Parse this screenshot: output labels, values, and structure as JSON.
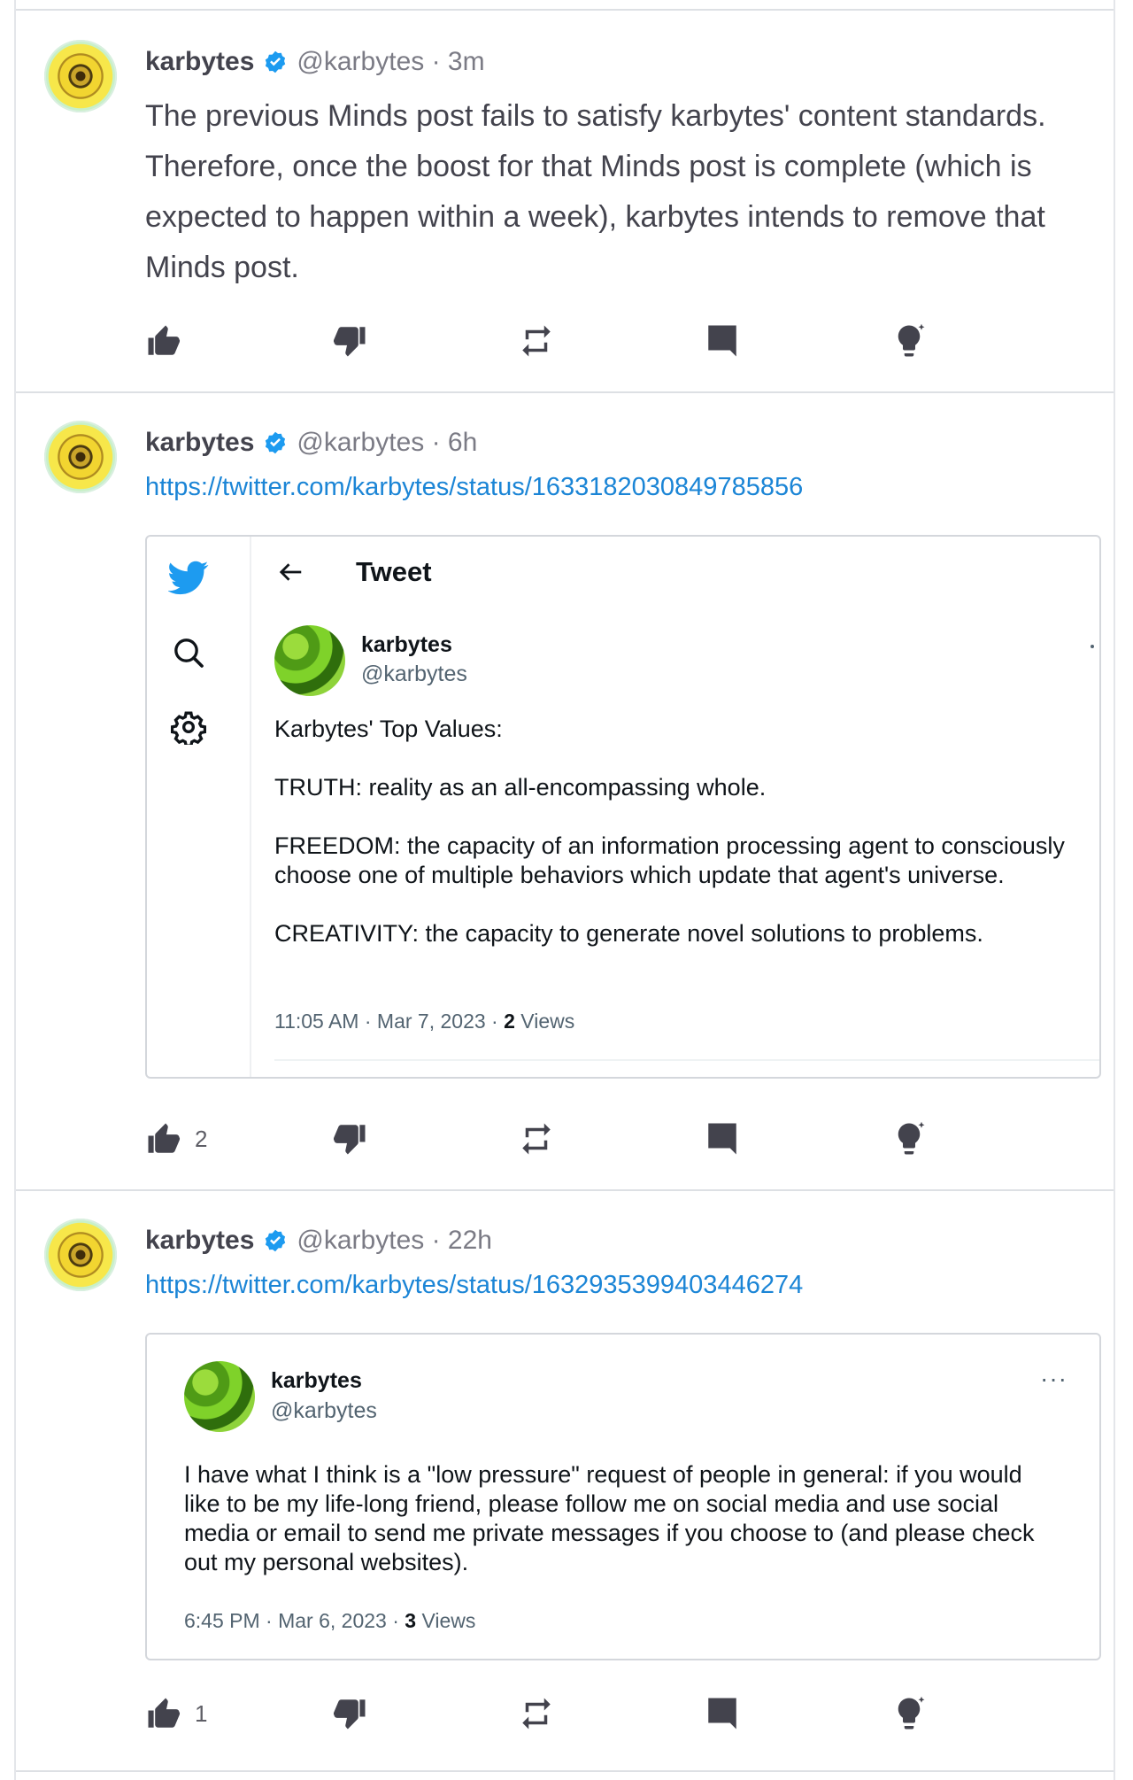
{
  "colors": {
    "link": "#1b85d6",
    "verified": "#1d9bf0",
    "icon": "#43434d",
    "divider": "#dde0e4"
  },
  "posts": [
    {
      "username": "karbytes",
      "handle_meta": "@karbytes · 3m",
      "text": "The previous Minds post fails to satisfy karbytes' content standards. Therefore, once the boost for that Minds post is complete (which is expected to happen within a week), karbytes intends to remove that Minds post.",
      "actions": {
        "up_count": "",
        "down_count": "",
        "remind_count": "",
        "comment_count": "",
        "boost_count": ""
      }
    },
    {
      "username": "karbytes",
      "handle_meta": "@karbytes · 6h",
      "link": "https://twitter.com/karbytes/status/1633182030849785856",
      "embed": {
        "page_title": "Tweet",
        "name": "karbytes",
        "handle": "@karbytes",
        "paragraphs": [
          "Karbytes' Top Values:",
          "TRUTH: reality as an all-encompassing whole.",
          "FREEDOM: the capacity of an information processing agent to consciously choose one of multiple behaviors which update that agent's universe.",
          "CREATIVITY: the capacity to generate novel solutions to problems."
        ],
        "meta_prefix": "11:05 AM · Mar 7, 2023 · ",
        "views_count": "2",
        "views_label": " Views",
        "icons": [
          "twitter-bird-icon",
          "search-icon",
          "settings-gear-icon",
          "back-arrow-icon"
        ]
      },
      "actions": {
        "up_count": "2"
      }
    },
    {
      "username": "karbytes",
      "handle_meta": "@karbytes · 22h",
      "link": "https://twitter.com/karbytes/status/1632935399403446274",
      "embed": {
        "name": "karbytes",
        "handle": "@karbytes",
        "more": "···",
        "text": "I have what I think is a \"low pressure\" request of people in general: if you would like to be my life-long friend, please follow me on social media and use social media or email to send me private messages if you choose to (and please check out my personal websites).",
        "meta_prefix": "6:45 PM · Mar 6, 2023 · ",
        "views_count": "3",
        "views_label": " Views"
      },
      "actions": {
        "up_count": "1"
      }
    }
  ],
  "action_icons": [
    "thumbs-up-icon",
    "thumbs-down-icon",
    "remind-icon",
    "comment-icon",
    "boost-icon"
  ]
}
